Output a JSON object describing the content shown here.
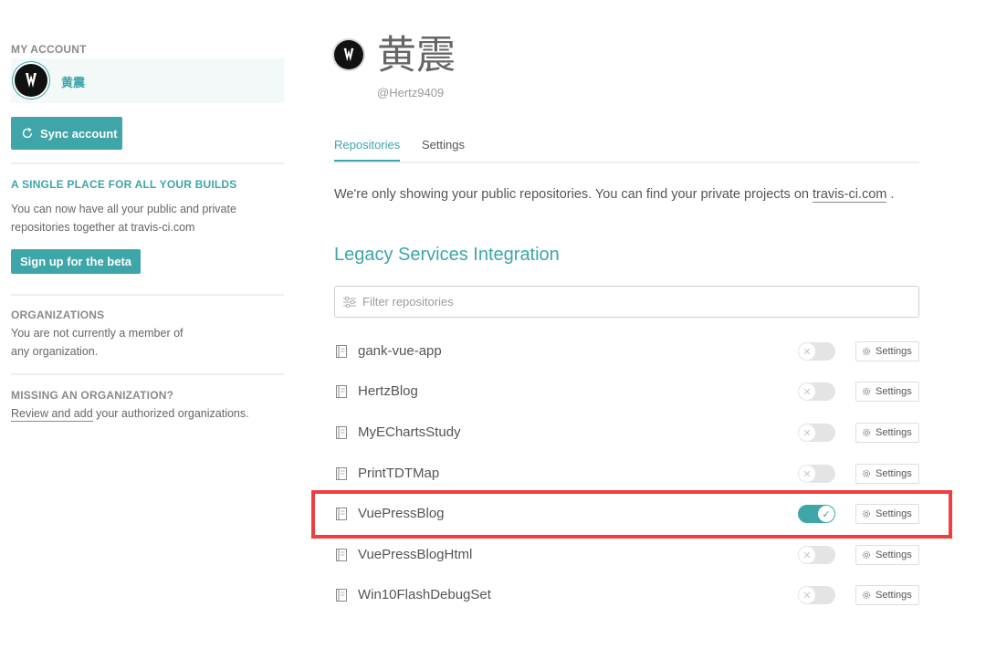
{
  "sidebar": {
    "account_heading": "MY ACCOUNT",
    "account_name": "黄震",
    "sync_label": "Sync account",
    "beta_heading": "A SINGLE PLACE FOR ALL YOUR BUILDS",
    "beta_text_line1": "You can now have all your public and private",
    "beta_text_line2": "repositories together at travis-ci.com",
    "beta_button": "Sign up for the beta",
    "org_heading": "ORGANIZATIONS",
    "org_text_line1": "You are not currently a member of",
    "org_text_line2": "any organization.",
    "missing_heading": "MISSING AN ORGANIZATION?",
    "missing_link": "Review and add",
    "missing_text": " your authorized organizations."
  },
  "profile": {
    "name": "黄震",
    "handle": "@Hertz9409"
  },
  "tabs": [
    {
      "label": "Repositories",
      "active": true
    },
    {
      "label": "Settings",
      "active": false
    }
  ],
  "notice": {
    "text": "We're only showing your public repositories. You can find your private projects on ",
    "link": "travis-ci.com",
    "suffix": " ."
  },
  "legacy_title": "Legacy Services Integration",
  "filter_placeholder": "Filter repositories",
  "settings_label": "Settings",
  "repositories": [
    {
      "name": "gank-vue-app",
      "enabled": false
    },
    {
      "name": "HertzBlog",
      "enabled": false
    },
    {
      "name": "MyEChartsStudy",
      "enabled": false
    },
    {
      "name": "PrintTDTMap",
      "enabled": false
    },
    {
      "name": "VuePressBlog",
      "enabled": true,
      "highlighted": true
    },
    {
      "name": "VuePressBlogHtml",
      "enabled": false
    },
    {
      "name": "Win10FlashDebugSet",
      "enabled": false
    }
  ],
  "colors": {
    "accent": "#3ea5a9",
    "highlight": "#f03e3e"
  }
}
